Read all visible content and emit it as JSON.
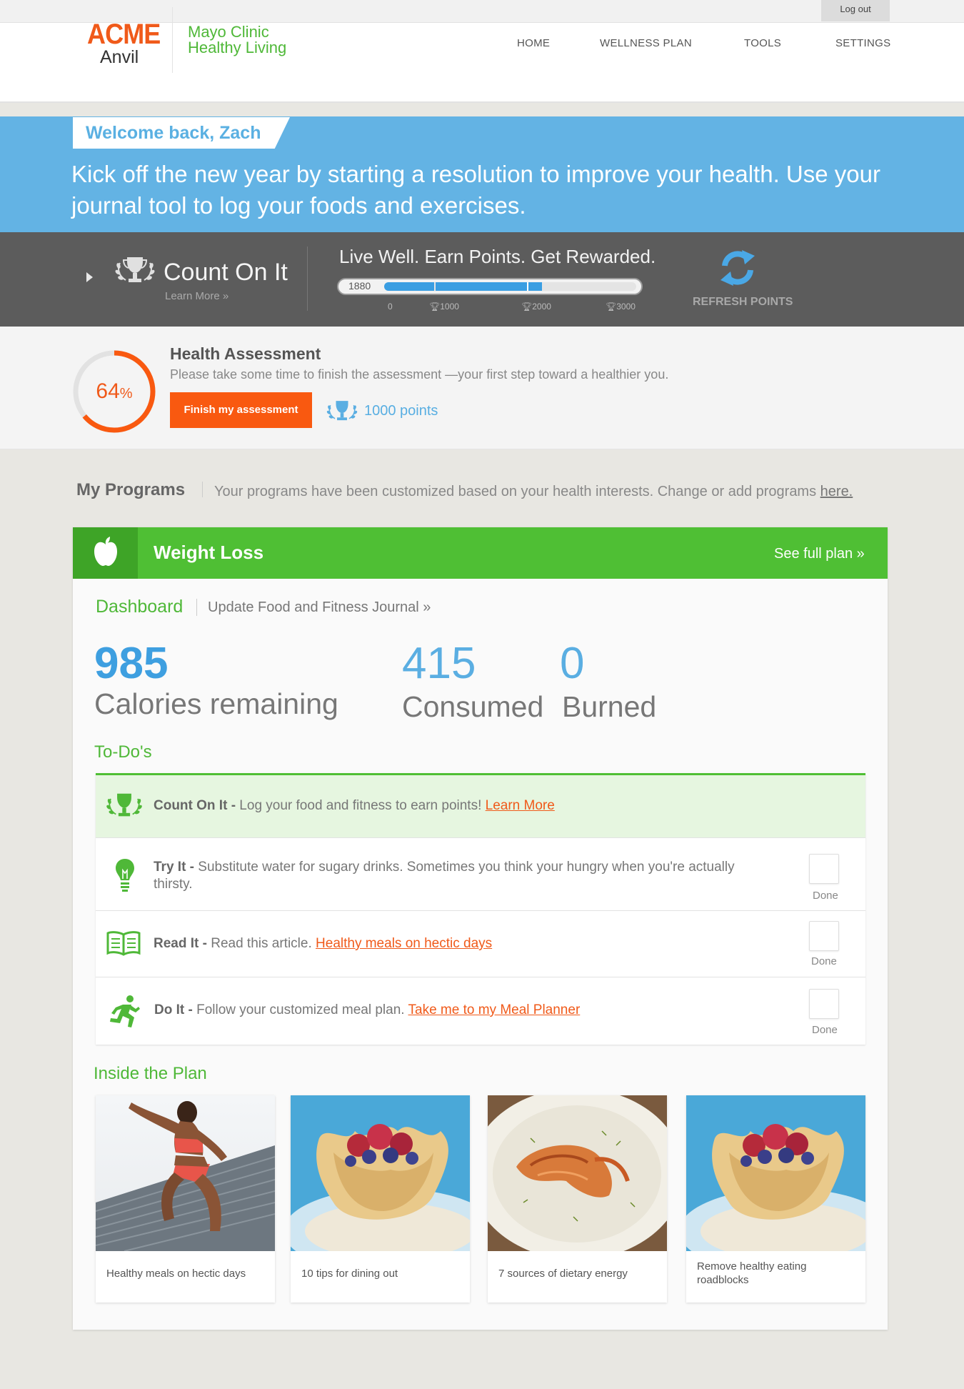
{
  "topbar": {
    "logout_label": "Log out"
  },
  "brand": {
    "acme": "ACME",
    "anvil": "Anvil",
    "partner_line1": "Mayo Clinic",
    "partner_line2": "Healthy Living"
  },
  "nav": {
    "items": [
      {
        "label": "HOME"
      },
      {
        "label": "WELLNESS PLAN"
      },
      {
        "label": "TOOLS"
      },
      {
        "label": "SETTINGS"
      }
    ]
  },
  "banner": {
    "welcome": "Welcome back, Zach",
    "message": "Kick off the new year by starting a resolution to improve your health. Use your journal tool to log your foods and exercises."
  },
  "points": {
    "title": "Count On It",
    "learn_more": "Learn More »",
    "tagline": "Live Well. Earn Points. Get Rewarded.",
    "current": "1880",
    "progress_fraction": 0.627,
    "ticks": [
      "0",
      "1000",
      "2000",
      "3000"
    ],
    "refresh_label": "REFRESH POINTS"
  },
  "assessment": {
    "percent": "64",
    "percent_sign": "%",
    "percent_fraction": 0.64,
    "title": "Health Assessment",
    "description": "Please take some time to finish the assessment —your first step toward a healthier you.",
    "button_label": "Finish my assessment",
    "points_label": "1000 points"
  },
  "programs": {
    "title": "My Programs",
    "description": "Your programs have been customized based on your health interests. Change or add programs ",
    "link": "here."
  },
  "plan": {
    "title": "Weight Loss",
    "full_plan": "See full plan »",
    "tab_dashboard": "Dashboard",
    "tab_journal": "Update Food and Fitness Journal »",
    "stats": {
      "remaining_value": "985",
      "remaining_label": "Calories remaining",
      "consumed_value": "415",
      "consumed_label": "Consumed",
      "burned_value": "0",
      "burned_label": "Burned"
    },
    "todos_title": "To-Do's",
    "todos": [
      {
        "prefix": "Count On It -",
        "text": " Log your food and fitness to earn points! ",
        "link": "Learn More"
      },
      {
        "prefix": "Try It -",
        "text": " Substitute water for sugary drinks. Sometimes you think your hungry when you're actually thirsty.",
        "done": "Done"
      },
      {
        "prefix": "Read It -",
        "text": " Read this article. ",
        "link": "Healthy meals on hectic days",
        "done": "Done"
      },
      {
        "prefix": "Do It -",
        "text": " Follow your customized meal plan. ",
        "link": "Take me to my Meal Planner",
        "done": "Done"
      }
    ],
    "inside_title": "Inside the Plan",
    "tiles": [
      {
        "caption": "Healthy meals on hectic days"
      },
      {
        "caption": "10 tips for dining out"
      },
      {
        "caption": "7 sources of dietary energy"
      },
      {
        "caption": "Remove healthy eating roadblocks"
      }
    ]
  },
  "colors": {
    "brand_orange": "#f05a1a",
    "brand_green": "#4fbf34",
    "banner_blue": "#63b3e4",
    "points_gray": "#5c5c5c"
  }
}
